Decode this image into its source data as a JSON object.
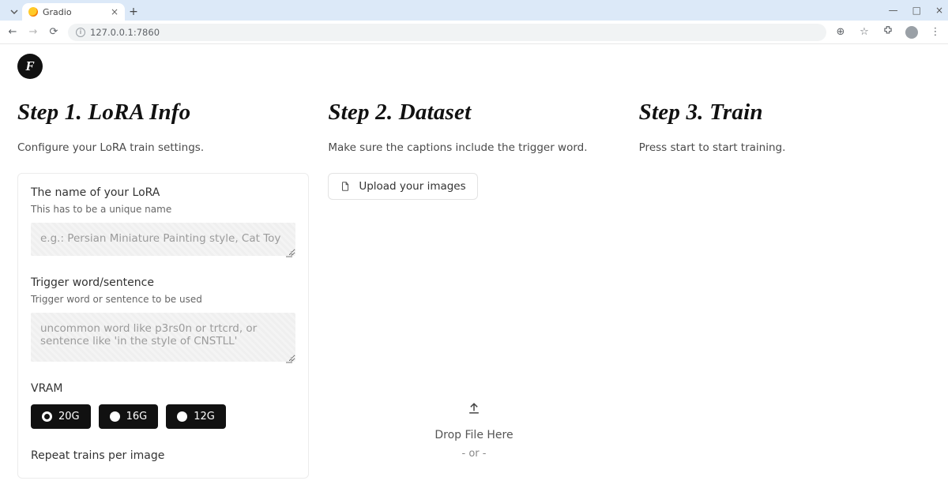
{
  "browser": {
    "tab_title": "Gradio",
    "url": "127.0.0.1:7860"
  },
  "brand": {
    "letter": "F"
  },
  "step1": {
    "title": "Step 1. LoRA Info",
    "desc": "Configure your LoRA train settings.",
    "name_label": "The name of your LoRA",
    "name_sub": "This has to be a unique name",
    "name_placeholder": "e.g.: Persian Miniature Painting style, Cat Toy",
    "trigger_label": "Trigger word/sentence",
    "trigger_sub": "Trigger word or sentence to be used",
    "trigger_placeholder": "uncommon word like p3rs0n or trtcrd, or sentence like 'in the style of CNSTLL'",
    "vram_label": "VRAM",
    "vram_options": [
      "20G",
      "16G",
      "12G"
    ],
    "vram_selected": "20G",
    "repeat_label": "Repeat trains per image"
  },
  "step2": {
    "title": "Step 2. Dataset",
    "desc": "Make sure the captions include the trigger word.",
    "upload_label": "Upload your images",
    "drop_label": "Drop File Here",
    "drop_or": "- or -"
  },
  "step3": {
    "title": "Step 3. Train",
    "desc": "Press start to start training."
  }
}
